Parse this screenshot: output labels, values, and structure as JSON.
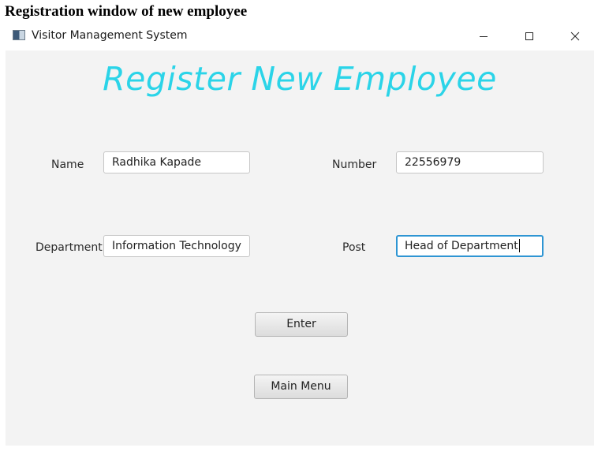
{
  "caption": "Registration window of new employee",
  "window": {
    "title": "Visitor Management System",
    "minimize_glyph": "─",
    "maximize_glyph": "☐",
    "close_glyph": "✕"
  },
  "form": {
    "heading": "Register New Employee",
    "name_label": "Name",
    "name_value": "Radhika Kapade",
    "number_label": "Number",
    "number_value": "22556979",
    "department_label": "Department",
    "department_value": "Information Technology",
    "post_label": "Post",
    "post_value": "Head of Department",
    "enter_label": "Enter",
    "main_menu_label": "Main Menu"
  },
  "colors": {
    "heading": "#2bd4e8",
    "focus_border": "#2e95d3",
    "content_bg": "#f3f3f3"
  }
}
